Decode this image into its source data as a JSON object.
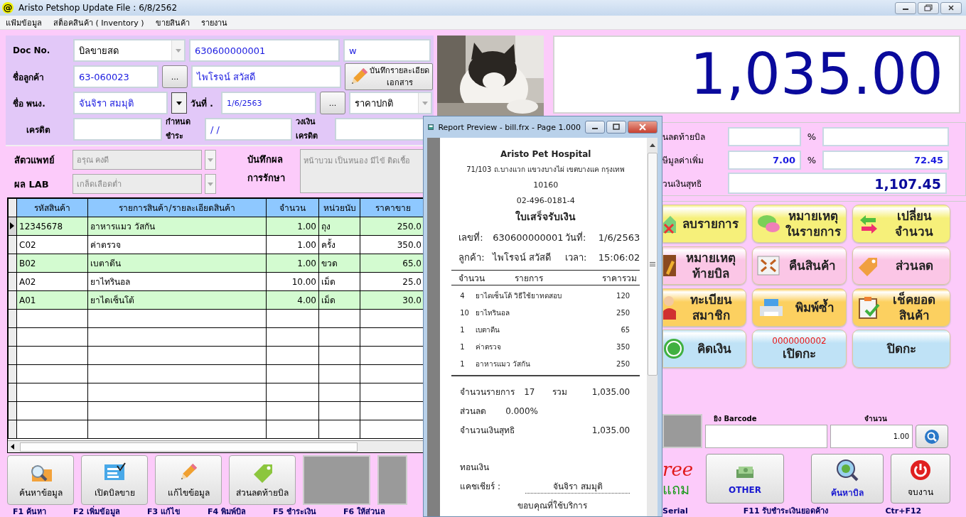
{
  "window": {
    "app_icon": "@",
    "title": "Aristo Petshop  Update File : 6/8/2562"
  },
  "menu": [
    "แฟ้มข้อมูล",
    "สต็อคสินค้า ( Inventory )",
    "ขายสินค้า",
    "รายงาน"
  ],
  "form": {
    "doc_no": {
      "label": "Doc No.",
      "doc_type": "บิลขายสด",
      "number": "630600000001",
      "extra": "w"
    },
    "customer": {
      "label": "ชื่อลูกค้า",
      "code": "63-060023",
      "browse": "...",
      "name": "ไพโรจน์ สวัสดี",
      "detail_button": "บันทึกรายละเอียด\nเอกสาร"
    },
    "staff": {
      "label": "ชื่อ พนง.",
      "name": "จันจิรา สมมุติ",
      "date_label": "วันที่ .",
      "date": "1/6/2563",
      "browse": "...",
      "price_type": "ราคาปกติ"
    },
    "credit": {
      "label": "เครดิต",
      "due_label": "กำหนด\nชำระ",
      "due": "/ /",
      "limit_label": "วงเงิน\nเครดิต"
    }
  },
  "treatment": {
    "vet_label": "สัตวแพทย์",
    "vet": "อรุณ คงดี",
    "lab_label": "ผล LAB",
    "lab": "เกล็ดเลือดต่ำ",
    "disabled": true,
    "notes_label": "บันทึกผล\nการรักษา",
    "notes": "หน้าบวม เป็นหนอง มีไข้ ติดเชื้อ"
  },
  "table": {
    "columns": [
      "รหัสสินค้า",
      "รายการสินค้า/รายละเอียดสินค้า",
      "จำนวน",
      "หน่วยนับ",
      "ราคาขาย"
    ],
    "rows": [
      {
        "cells": [
          "12345678",
          "อาหารแมว วัสกัน",
          "1.00",
          "ถุง",
          "250.0"
        ],
        "selected": true
      },
      {
        "cells": [
          "C02",
          "ค่าตรวจ",
          "1.00",
          "ครั้ง",
          "350.0"
        ],
        "selected": false
      },
      {
        "cells": [
          "B02",
          "เบตาดีน",
          "1.00",
          "ขวด",
          "65.0"
        ],
        "selected": false
      },
      {
        "cells": [
          "A02",
          "ยาไทรินอล",
          "10.00",
          "เม็ด",
          "25.0"
        ],
        "selected": false
      },
      {
        "cells": [
          "A01",
          "ยาไดเซ็นโต้",
          "4.00",
          "เม็ด",
          "30.0"
        ],
        "selected": false
      }
    ]
  },
  "left_buttons": [
    {
      "kind": "button",
      "label": "ค้นหาข้อมูล"
    },
    {
      "kind": "button",
      "label": "เปิดบิลขาย"
    },
    {
      "kind": "button",
      "label": "แก้ไขข้อมูล"
    },
    {
      "kind": "button",
      "label": "ส่วนลดท้ายบิล"
    },
    {
      "kind": "blank"
    },
    {
      "kind": "blank"
    }
  ],
  "function_keys_left": [
    "F1 ค้นหา",
    "F2 เพิ่มข้อมูล",
    "F3 แก้ไข",
    "F4 พิมพ์บิล",
    "F5 ชำระเงิน",
    "F6 ให้ส่วนล"
  ],
  "photo": {
    "kind": "picture"
  },
  "total": "1,035.00",
  "summary": [
    {
      "label": "นลดท้ายบิล",
      "unit": "%"
    },
    {
      "label": "ษีมูลค่าเพิ่ม",
      "percent": "7.00",
      "unit": "%",
      "amount": "72.45"
    }
  ],
  "net": {
    "label": "วนเงินสุทธิ",
    "value": "1,107.45"
  },
  "actions": [
    {
      "label": "ลบรายการ",
      "color": "#f6f07a"
    },
    {
      "label": "หมายเหตุ\nในรายการ",
      "color": "#f6f07a"
    },
    {
      "label": "เปลี่ยน\nจำนวน",
      "color": "#f6f07a"
    },
    {
      "label": "หมายเหตุ\nท้ายบิล",
      "color": "#fbc6e6"
    },
    {
      "label": "คืนสินค้า",
      "color": "#fbc6e6"
    },
    {
      "label": "ส่วนลด",
      "color": "#fbc6e6"
    },
    {
      "label": "ทะเบียน\nสมาชิก",
      "color": "#fcd060"
    },
    {
      "label": "พิมพ์ซ้ำ",
      "color": "#fcd060"
    },
    {
      "label": "เช็คยอด\nสินค้า",
      "color": "#fcd060"
    },
    {
      "label": "คิดเงิน",
      "color": "#bfe2f6"
    },
    {
      "label": "เปิดกะ",
      "counter": "0000000002",
      "color": "#bfe2f6"
    },
    {
      "label": "ปิดกะ",
      "color": "#bfe2f6"
    }
  ],
  "barcode": {
    "label": "ยิง Barcode",
    "qty_label": "จำนวน",
    "qty": "1.00"
  },
  "bottom_right": [
    {
      "kind": "logo",
      "text": "ree",
      "label": "แถม"
    },
    {
      "kind": "button",
      "label": "OTHER"
    },
    {
      "kind": "button",
      "label": "ค้นหาบิล"
    },
    {
      "kind": "button",
      "label": "จบงาน"
    }
  ],
  "function_keys_right": [
    "Serial",
    "F11 รับชำระเงินยอดค้าง",
    "Ctr+F12"
  ],
  "report": {
    "title": "Report Preview - bill.frx - Page 1.000",
    "company": "Aristo Pet Hospital",
    "address": "71/103 ถ.บางแวก แขวงบางไผ่  เขตบางแค กรุงเทพ",
    "postcode": "10160",
    "phone": "02-496-0181-4",
    "heading": "ใบเสร็จรับเงิน",
    "fields": [
      {
        "label": "เลขที่:",
        "value": "630600000001"
      },
      {
        "label": "วันที่:",
        "value": "1/6/2563"
      },
      {
        "label": "ลูกค้า:",
        "value": "ไพโรจน์ สวัสดี"
      },
      {
        "label": "เวลา:",
        "value": "15:06:02"
      }
    ],
    "columns": [
      "จำนวน",
      "รายการ",
      "ราคารวม"
    ],
    "items": [
      [
        "4",
        "ยาไดเซ็นโต้ วิธีใช้ยาทดสอบ",
        "120"
      ],
      [
        "10",
        "ยาไทรินอล",
        "250"
      ],
      [
        "1",
        "เบตาดีน",
        "65"
      ],
      [
        "1",
        "ค่าตรวจ",
        "350"
      ],
      [
        "1",
        "อาหารแมว วัสกัน",
        "250"
      ]
    ],
    "count_label": "จำนวนรายการ",
    "count": "17",
    "sum_label": "รวม",
    "sum": "1,035.00",
    "discount_label": "ส่วนลด",
    "discount": "0.000%",
    "net_label": "จำนวนเงินสุทธิ",
    "net": "1,035.00",
    "change_label": "ทอนเงิน",
    "cashier_label": "แคชเชียร์ :",
    "cashier": "จันจิรา สมมุติ",
    "thanks": "ขอบคุณที่ใช้บริการ"
  }
}
